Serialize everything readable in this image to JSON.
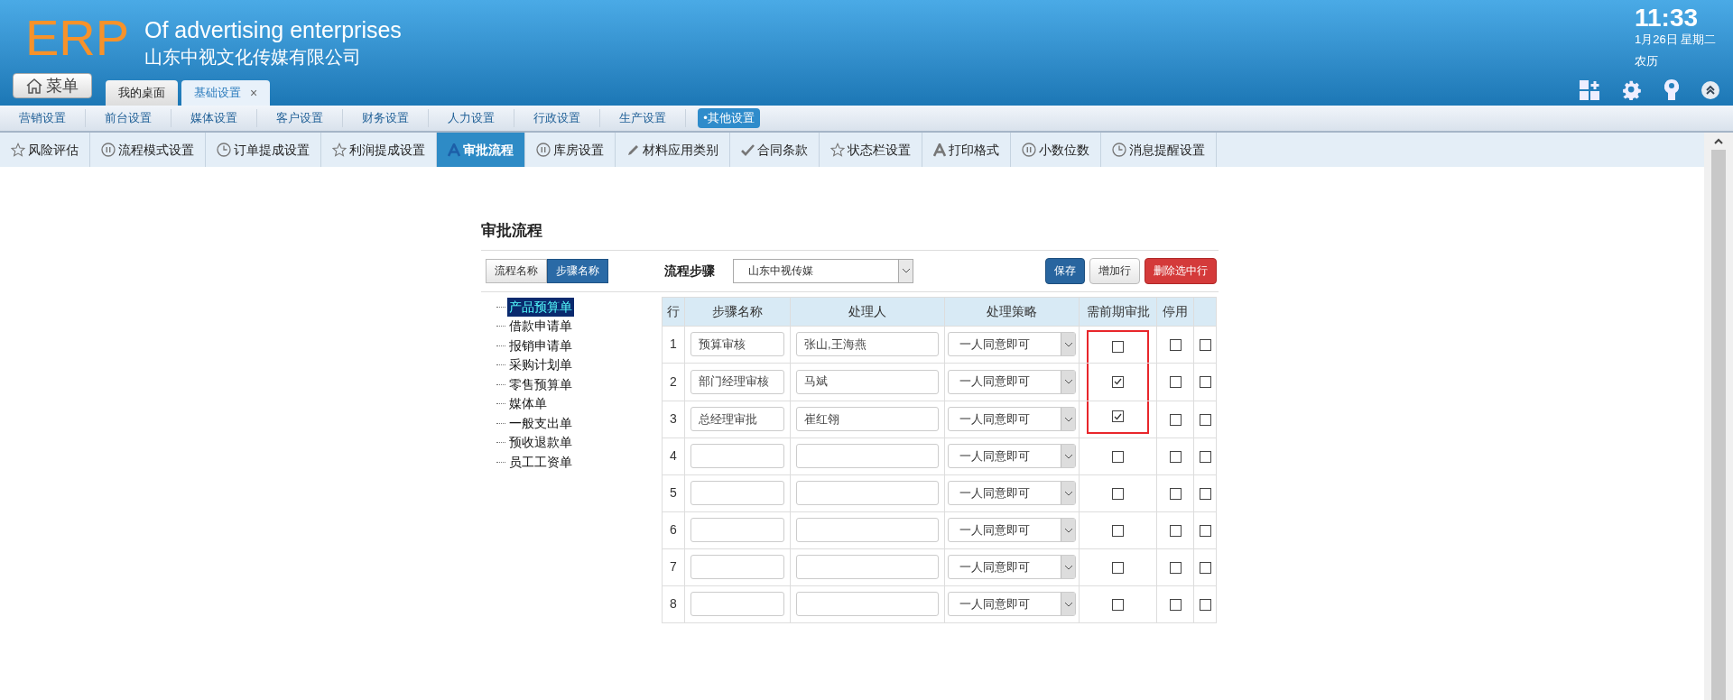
{
  "header": {
    "logo": "ERP",
    "title": "Of advertising enterprises",
    "company": "山东中视文化传媒有限公司",
    "menu_button": "菜单",
    "clock": {
      "time": "11:33",
      "date": "1月26日 星期二",
      "lunar": "农历"
    }
  },
  "tabs": [
    {
      "label": "我的桌面",
      "selected": false,
      "closable": false
    },
    {
      "label": "基础设置",
      "selected": true,
      "closable": true,
      "close": "×"
    }
  ],
  "main_nav": [
    {
      "label": "营销设置",
      "selected": false
    },
    {
      "label": "前台设置",
      "selected": false
    },
    {
      "label": "媒体设置",
      "selected": false
    },
    {
      "label": "客户设置",
      "selected": false
    },
    {
      "label": "财务设置",
      "selected": false
    },
    {
      "label": "人力设置",
      "selected": false
    },
    {
      "label": "行政设置",
      "selected": false
    },
    {
      "label": "生产设置",
      "selected": false
    },
    {
      "label": "•其他设置",
      "selected": true
    }
  ],
  "sub_nav": [
    {
      "label": "风险评估",
      "kind": "star",
      "selected": false
    },
    {
      "label": "流程模式设置",
      "kind": "pause",
      "selected": false
    },
    {
      "label": "订单提成设置",
      "kind": "clock",
      "selected": false
    },
    {
      "label": "利润提成设置",
      "kind": "star",
      "selected": false
    },
    {
      "label": "审批流程",
      "kind": "letter",
      "selected": true
    },
    {
      "label": "库房设置",
      "kind": "pause",
      "selected": false
    },
    {
      "label": "材料应用类别",
      "kind": "pencil",
      "selected": false
    },
    {
      "label": "合同条款",
      "kind": "check",
      "selected": false
    },
    {
      "label": "状态栏设置",
      "kind": "star",
      "selected": false
    },
    {
      "label": "打印格式",
      "kind": "letter",
      "selected": false
    },
    {
      "label": "小数位数",
      "kind": "pause",
      "selected": false
    },
    {
      "label": "消息提醒设置",
      "kind": "clock",
      "selected": false
    }
  ],
  "panel": {
    "title": "审批流程",
    "view_toggle": [
      {
        "label": "流程名称",
        "selected": false
      },
      {
        "label": "步骤名称",
        "selected": true
      }
    ],
    "flow_label": "流程步骤",
    "flow_select": "山东中视传媒",
    "buttons": [
      {
        "label": "保存",
        "kind": "primary"
      },
      {
        "label": "增加行",
        "kind": "default"
      },
      {
        "label": "删除选中行",
        "kind": "danger"
      }
    ],
    "tree": [
      {
        "label": "产品预算单",
        "selected": true
      },
      {
        "label": "借款申请单",
        "selected": false
      },
      {
        "label": "报销申请单",
        "selected": false
      },
      {
        "label": "采购计划单",
        "selected": false
      },
      {
        "label": "零售预算单",
        "selected": false
      },
      {
        "label": "媒体单",
        "selected": false
      },
      {
        "label": "一般支出单",
        "selected": false
      },
      {
        "label": "预收退款单",
        "selected": false
      },
      {
        "label": "员工工资单",
        "selected": false
      }
    ],
    "table": {
      "columns": [
        "行",
        "步骤名称",
        "处理人",
        "处理策略",
        "需前期审批",
        "停用"
      ],
      "rows": [
        {
          "row": "1",
          "step_name": "预算审核",
          "handler": "张山,王海燕",
          "strategy": "一人同意即可",
          "prior_approval": false,
          "disabled": false,
          "selected": false,
          "framed": true
        },
        {
          "row": "2",
          "step_name": "部门经理审核",
          "handler": "马斌",
          "strategy": "一人同意即可",
          "prior_approval": true,
          "disabled": false,
          "selected": false,
          "framed": true
        },
        {
          "row": "3",
          "step_name": "总经理审批",
          "handler": "崔红翎",
          "strategy": "一人同意即可",
          "prior_approval": true,
          "disabled": false,
          "selected": false,
          "framed": true
        },
        {
          "row": "4",
          "strategy": "一人同意即可",
          "prior_approval": false,
          "disabled": false,
          "selected": false,
          "framed": false
        },
        {
          "row": "5",
          "strategy": "一人同意即可",
          "prior_approval": false,
          "disabled": false,
          "selected": false,
          "framed": false
        },
        {
          "row": "6",
          "strategy": "一人同意即可",
          "prior_approval": false,
          "disabled": false,
          "selected": false,
          "framed": false
        },
        {
          "row": "7",
          "strategy": "一人同意即可",
          "prior_approval": false,
          "disabled": false,
          "selected": false,
          "framed": false
        },
        {
          "row": "8",
          "strategy": "一人同意即可",
          "prior_approval": false,
          "disabled": false,
          "selected": false,
          "framed": false
        }
      ]
    }
  }
}
